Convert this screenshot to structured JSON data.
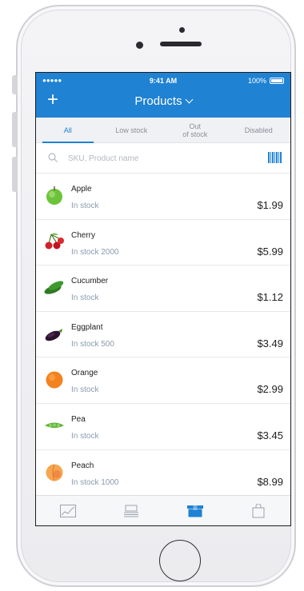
{
  "status_bar": {
    "signal": "●●●●● ",
    "time": "9:41 AM",
    "battery": "100%"
  },
  "nav": {
    "add_icon": "+",
    "title": "Products"
  },
  "tabs": [
    {
      "label": "All",
      "active": true
    },
    {
      "label": "Low stock",
      "active": false
    },
    {
      "label": "Out\nof stock",
      "active": false
    },
    {
      "label": "Disabled",
      "active": false
    }
  ],
  "search": {
    "placeholder": "SKU, Product name",
    "value": ""
  },
  "products": [
    {
      "name": "Apple",
      "stock": "In stock",
      "price": "$1.99",
      "icon": "apple-icon"
    },
    {
      "name": "Cherry",
      "stock": "In stock 2000",
      "price": "$5.99",
      "icon": "cherry-icon"
    },
    {
      "name": "Cucumber",
      "stock": "In stock",
      "price": "$1.12",
      "icon": "cucumber-icon"
    },
    {
      "name": "Eggplant",
      "stock": "In stock 500",
      "price": "$3.49",
      "icon": "eggplant-icon"
    },
    {
      "name": "Orange",
      "stock": "In stock",
      "price": "$2.99",
      "icon": "orange-icon"
    },
    {
      "name": "Pea",
      "stock": "In stock",
      "price": "$3.45",
      "icon": "pea-icon"
    },
    {
      "name": "Peach",
      "stock": "In stock 1000",
      "price": "$8.99",
      "icon": "peach-icon"
    }
  ],
  "tabbar": [
    {
      "icon": "chart-icon",
      "active": false
    },
    {
      "icon": "orders-stack-icon",
      "active": false
    },
    {
      "icon": "products-box-icon",
      "active": true
    },
    {
      "icon": "shopping-bag-icon",
      "active": false
    }
  ],
  "colors": {
    "accent": "#1f82d3",
    "muted_text": "#8a9bb0",
    "tab_inactive": "#8a9098"
  }
}
